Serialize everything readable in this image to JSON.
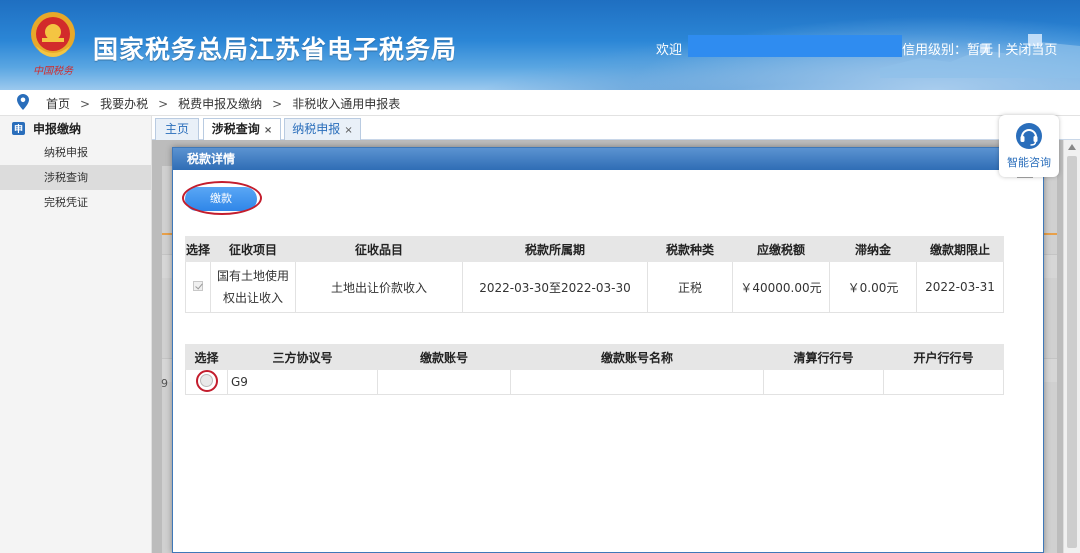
{
  "header": {
    "site_title": "国家税务总局江苏省电子税务局",
    "emblem_signature": "中国税务",
    "welcome": "欢迎",
    "credit_label": "信用级别：暂无",
    "separator": "|",
    "close_label": "关闭当页"
  },
  "breadcrumb": [
    "首页",
    "我要办税",
    "税费申报及缴纳",
    "非税收入通用申报表"
  ],
  "breadcrumb_arrow": ">",
  "sidebar": {
    "section_icon": "申",
    "section_title": "申报缴纳",
    "items": [
      "纳税申报",
      "涉税查询",
      "完税凭证"
    ]
  },
  "tabs": [
    {
      "label": "主页",
      "closable": false
    },
    {
      "label": "涉税查询",
      "closable": true,
      "active": true
    },
    {
      "label": "纳税申报",
      "closable": true
    }
  ],
  "tab_close": "×",
  "background_page": {
    "row_prefix": "9"
  },
  "modal": {
    "title": "税款详情",
    "pay_button": "缴款",
    "tax_table": {
      "headers": [
        "选择",
        "征收项目",
        "征收品目",
        "税款所属期",
        "税款种类",
        "应缴税额",
        "滞纳金",
        "缴款期限止"
      ],
      "rows": [
        [
          "",
          "国有土地使用权出让收入",
          "土地出让价款收入",
          "2022-03-30至2022-03-30",
          "正税",
          "￥40000.00元",
          "￥0.00元",
          "2022-03-31"
        ]
      ]
    },
    "account_table": {
      "headers": [
        "选择",
        "三方协议号",
        "缴款账号",
        "缴款账号名称",
        "清算行行号",
        "开户行行号"
      ],
      "rows": [
        [
          "",
          "G9",
          "",
          "",
          "",
          ""
        ]
      ]
    }
  },
  "consult": {
    "label": "智能咨询"
  },
  "colors": {
    "header_blue": "#2b86d6",
    "accent_blue": "#2a6ebb",
    "highlight_red": "#c31d2d",
    "pay_button": "#2f86e8"
  }
}
